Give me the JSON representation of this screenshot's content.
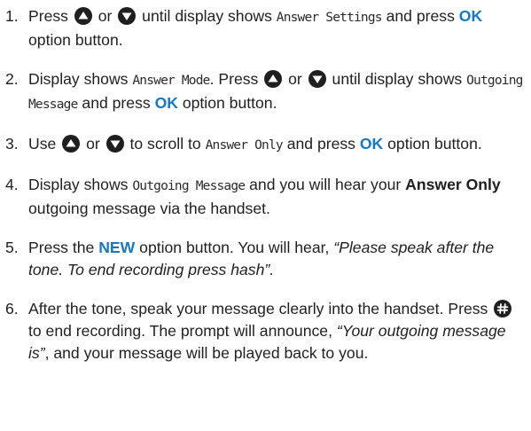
{
  "steps": [
    {
      "num": "1.",
      "a": "Press ",
      "or": " or ",
      "b": " until display shows ",
      "lcd1": "Answer Settings",
      "c": " and press ",
      "ok": "OK",
      "d": " option button."
    },
    {
      "num": "2.",
      "a": "Display shows ",
      "lcd1": "Answer Mode",
      "b": ". Press ",
      "or": " or ",
      "c": " until display shows ",
      "lcd2": "Outgoing Message",
      "d": " and press ",
      "ok": "OK",
      "e": " option button."
    },
    {
      "num": "3.",
      "a": "Use ",
      "or": " or ",
      "b": " to scroll to ",
      "lcd1": "Answer Only",
      "c": " and press ",
      "ok": "OK",
      "d": " option button."
    },
    {
      "num": "4.",
      "a": "Display shows ",
      "lcd1": "Outgoing Message",
      "b": " and you will hear your ",
      "bold": "Answer Only",
      "c": " outgoing message via the handset."
    },
    {
      "num": "5.",
      "a": "Press the ",
      "ok": "NEW",
      "b": " option button. You will hear, ",
      "quote": "“Please speak after the tone. To end recording press hash”."
    },
    {
      "num": "6.",
      "a": "After the tone, speak your message clearly into the handset. Press ",
      "b": " to end recording. The prompt will announce, ",
      "quote": "“Your outgoing message is”",
      "c": ", and your message will be played back to you."
    }
  ],
  "colors": {
    "accent": "#1877c6",
    "icon": "#1f1f1f"
  },
  "icons": {
    "up": "up-arrow-key-icon",
    "down": "down-arrow-key-icon",
    "hash": "hash-key-icon"
  }
}
